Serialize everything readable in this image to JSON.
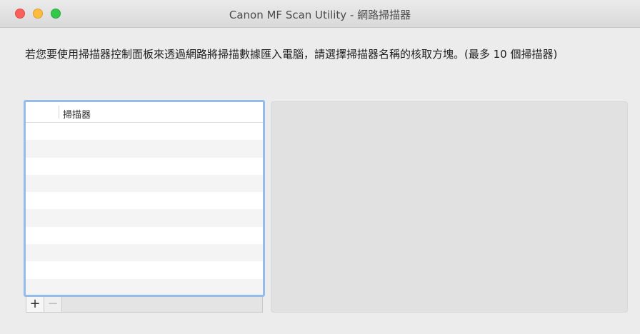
{
  "window": {
    "title": "Canon MF Scan Utility - 網路掃描器"
  },
  "instruction": "若您要使用掃描器控制面板來透過網路將掃描數據匯入電腦，請選擇掃描器名稱的核取方塊。(最多 10 個掃描器)",
  "scanner_table": {
    "column_header": "掃描器",
    "rows": []
  },
  "controls": {
    "add_label": "+",
    "remove_label": "−"
  },
  "colors": {
    "focus_ring": "#95bbea",
    "close": "#fc605c",
    "minimize": "#fdbc40",
    "zoom": "#34c84a"
  }
}
